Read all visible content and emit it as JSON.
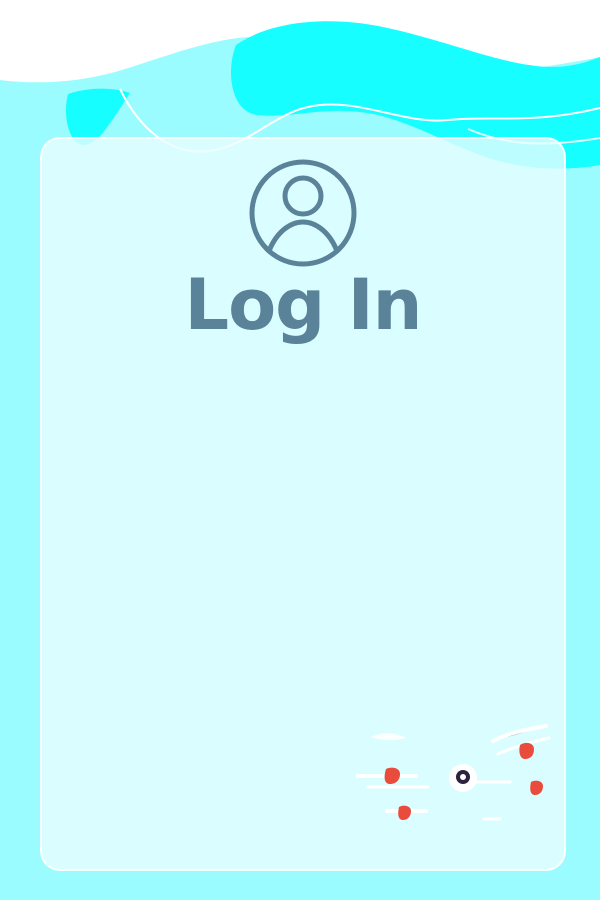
{
  "page": {
    "title": "Log In"
  },
  "icons": {
    "avatar": "user-avatar-icon",
    "illustration": "flying-hearts-illustration"
  },
  "colors": {
    "background": "#9bfcff",
    "wave_cyan": "#16feff",
    "card": "#ecfeff",
    "text": "#5a8298",
    "accent_red": "#e94b3c"
  }
}
